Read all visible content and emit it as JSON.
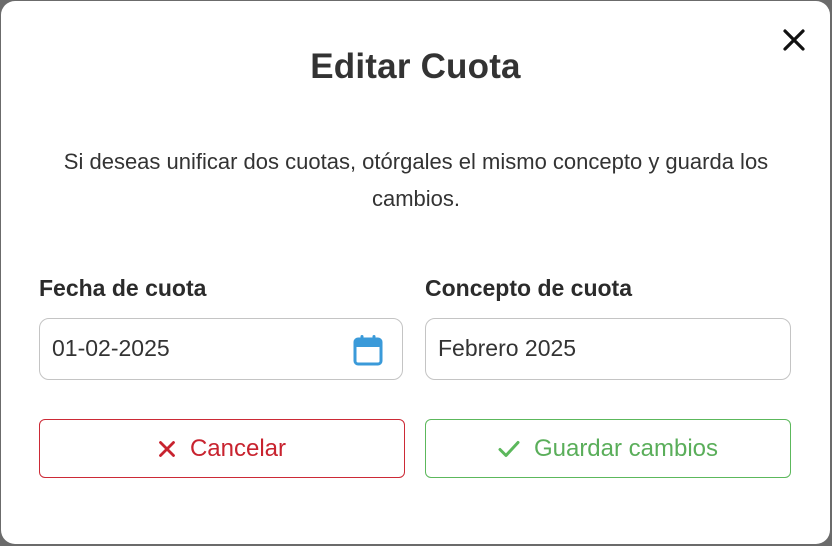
{
  "modal": {
    "title": "Editar Cuota",
    "description": "Si deseas unificar dos cuotas, otórgales el mismo concepto y guarda los cambios.",
    "close_icon": "close-icon"
  },
  "form": {
    "date_label": "Fecha de cuota",
    "date_value": "01-02-2025",
    "date_icon": "calendar-icon",
    "concept_label": "Concepto de cuota",
    "concept_value": "Febrero 2025"
  },
  "actions": {
    "cancel_label": "Cancelar",
    "cancel_icon": "x-icon",
    "save_label": "Guardar cambios",
    "save_icon": "check-icon"
  },
  "colors": {
    "danger": "#c8232f",
    "success": "#5cb85c",
    "calendar": "#3a9ad9"
  }
}
